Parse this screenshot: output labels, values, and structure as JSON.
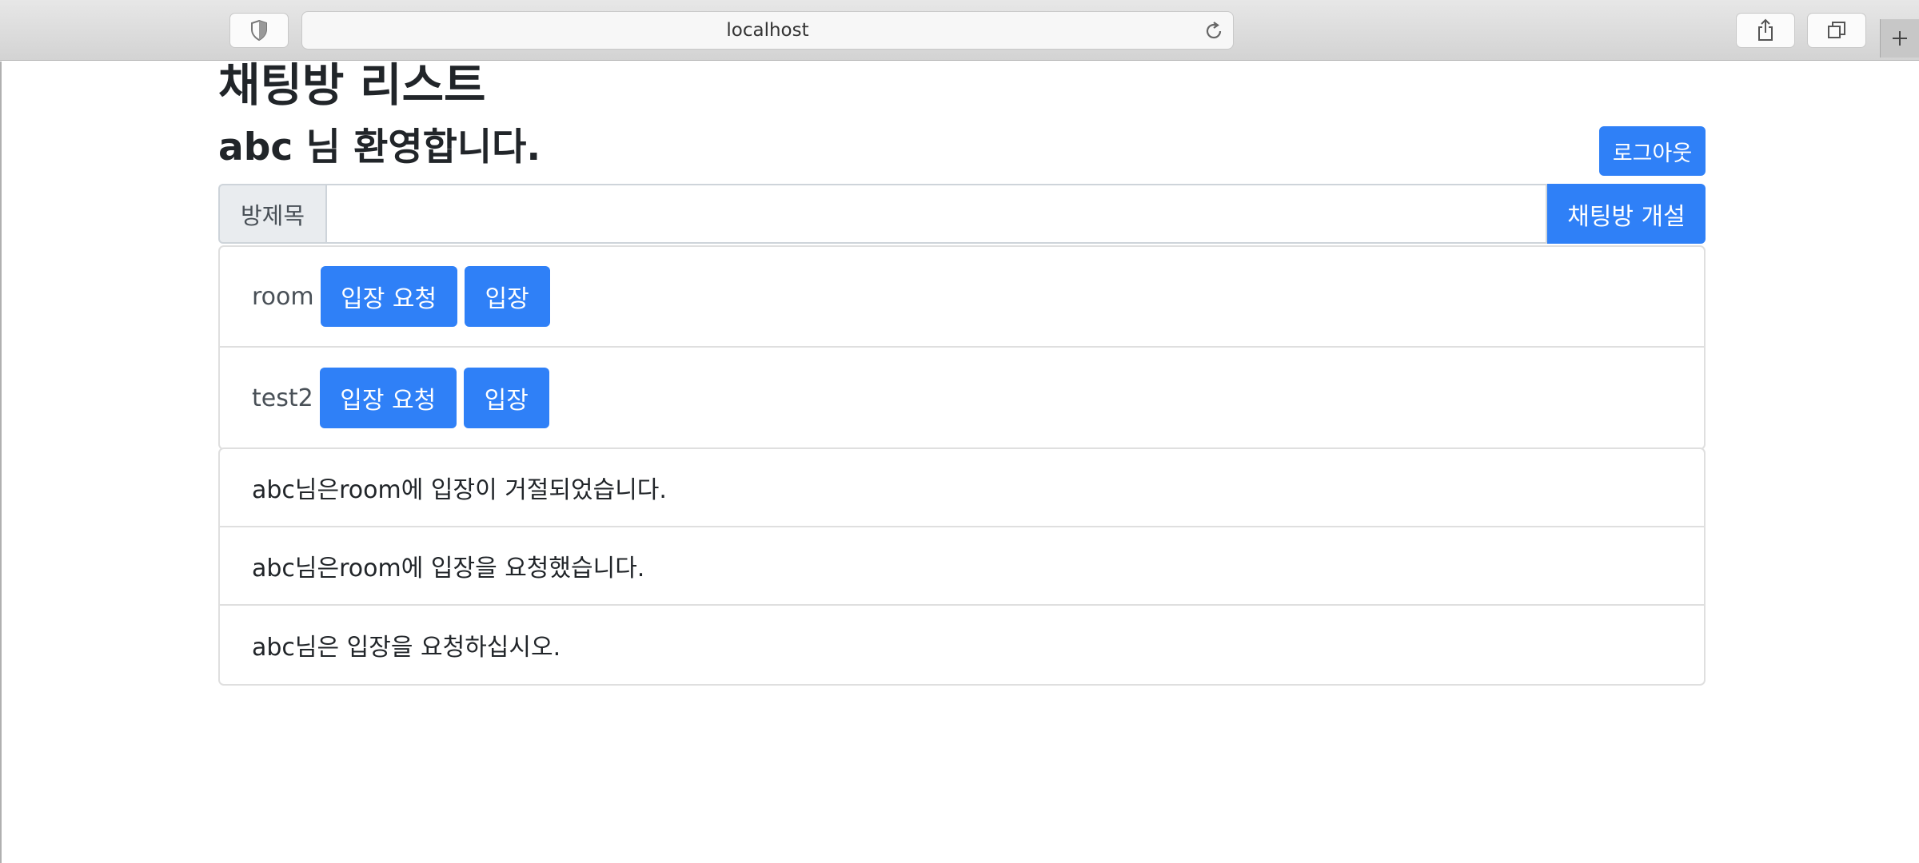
{
  "browser": {
    "url": "localhost"
  },
  "page": {
    "title": "채팅방 리스트",
    "welcome": "abc 님 환영합니다.",
    "logout_label": "로그아웃",
    "room_title_label": "방제목",
    "room_title_value": "",
    "create_label": "채팅방 개설"
  },
  "rooms": [
    {
      "name": "room",
      "request_label": "입장 요청",
      "enter_label": "입장"
    },
    {
      "name": "test2",
      "request_label": "입장 요청",
      "enter_label": "입장"
    }
  ],
  "messages": [
    "abc님은room에 입장이 거절되었습니다.",
    "abc님은room에 입장을 요청했습니다.",
    "abc님은 입장을 요청하십시오."
  ],
  "colors": {
    "primary": "#2f80f7",
    "border": "#dfdfdf"
  }
}
